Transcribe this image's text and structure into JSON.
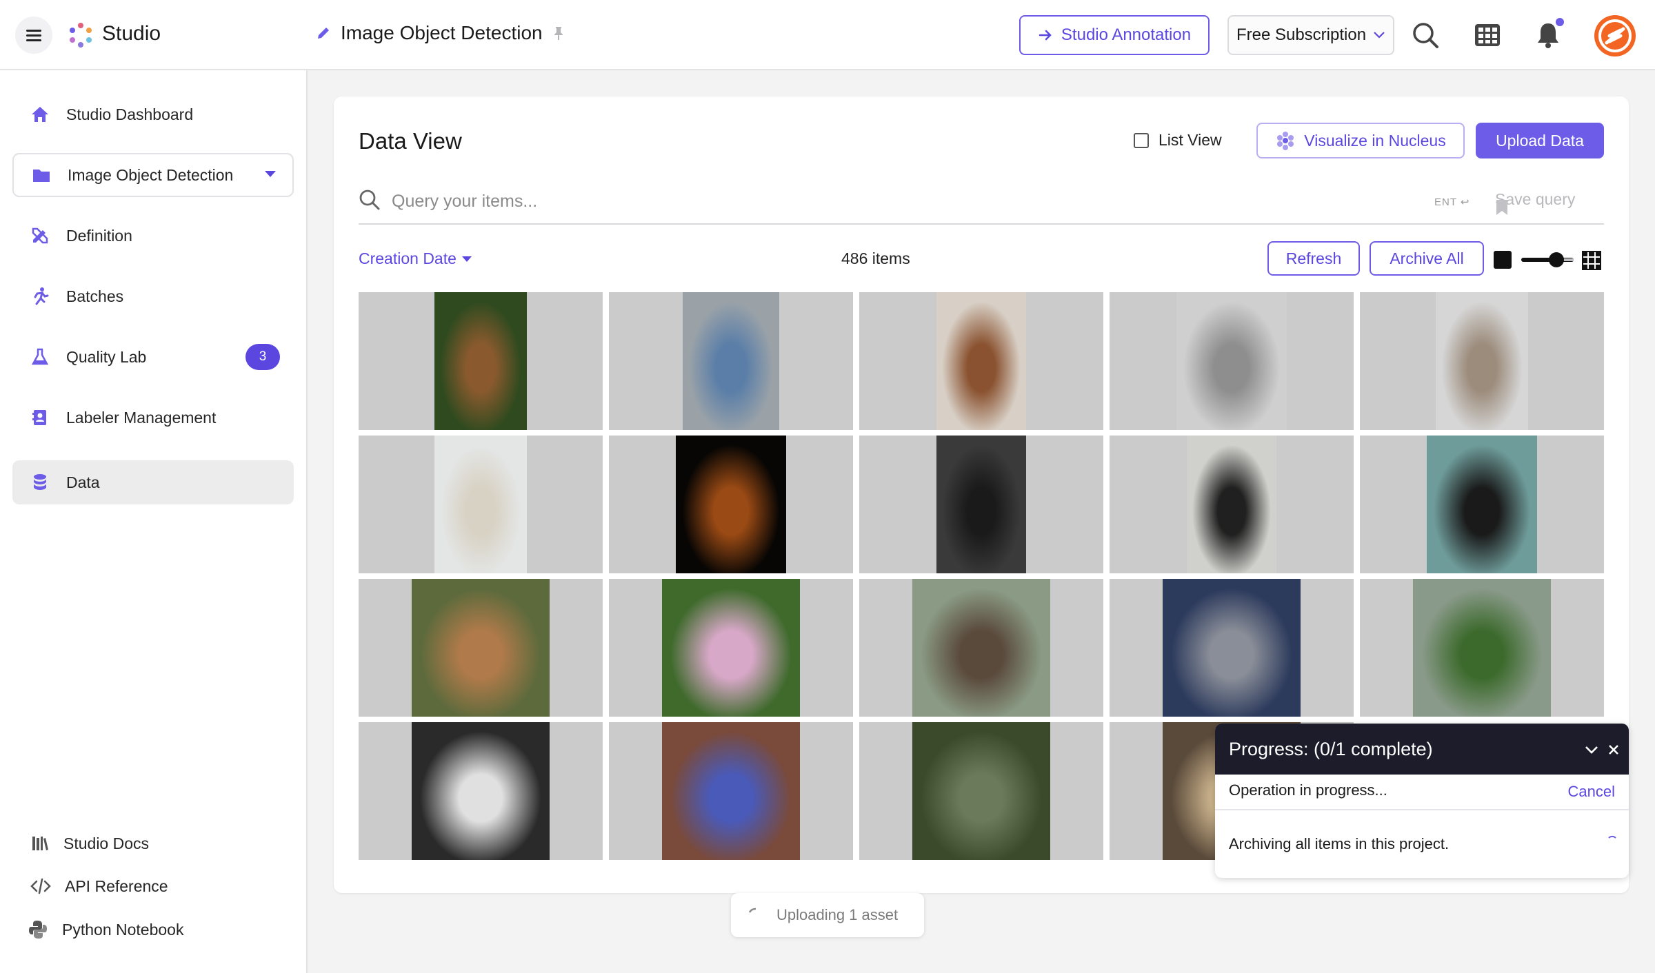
{
  "topbar": {
    "app_name": "Studio",
    "project_title": "Image Object Detection",
    "annotation_button": "Studio Annotation",
    "subscription": "Free Subscription"
  },
  "sidebar": {
    "items": [
      {
        "label": "Studio Dashboard",
        "icon": "home-icon"
      },
      {
        "label": "Image Object Detection",
        "icon": "folder-icon"
      },
      {
        "label": "Definition",
        "icon": "pencil-ruler-icon"
      },
      {
        "label": "Batches",
        "icon": "running-person-icon"
      },
      {
        "label": "Quality Lab",
        "icon": "flask-icon",
        "badge": "3"
      },
      {
        "label": "Labeler Management",
        "icon": "contact-book-icon"
      },
      {
        "label": "Data",
        "icon": "database-icon"
      }
    ],
    "footer": [
      {
        "label": "Studio Docs",
        "icon": "books-icon"
      },
      {
        "label": "API Reference",
        "icon": "code-icon"
      },
      {
        "label": "Python Notebook",
        "icon": "python-icon"
      }
    ]
  },
  "main": {
    "title": "Data View",
    "list_view_label": "List View",
    "visualize_button": "Visualize in Nucleus",
    "upload_button": "Upload Data",
    "search_placeholder": "Query your items...",
    "ent_hint": "ENT",
    "save_query": "Save query",
    "sort_label": "Creation Date",
    "item_count": "486 items",
    "refresh_button": "Refresh",
    "archive_all_button": "Archive All",
    "images": [
      {
        "subject": "wooden chair on grass",
        "colors": [
          "#2f4a1f",
          "#8a5a2e"
        ]
      },
      {
        "subject": "blue armchair",
        "colors": [
          "#9aa2a8",
          "#5a7ea8"
        ]
      },
      {
        "subject": "brown leather office chair",
        "colors": [
          "#d8d0c6",
          "#8a5230"
        ]
      },
      {
        "subject": "grey fabric chair",
        "colors": [
          "#cfcfcf",
          "#8e8e8e"
        ]
      },
      {
        "subject": "beige lounge chair",
        "colors": [
          "#d6d6d6",
          "#9c8c7c"
        ]
      },
      {
        "subject": "white tufted chair",
        "colors": [
          "#e4e6e6",
          "#d8d2c4"
        ]
      },
      {
        "subject": "chair in spotlight",
        "colors": [
          "#080604",
          "#9a4a14"
        ]
      },
      {
        "subject": "black plastic bar stool",
        "colors": [
          "#3a3a3a",
          "#1a1a1a"
        ]
      },
      {
        "subject": "black eames stool",
        "colors": [
          "#d0d0cc",
          "#202020"
        ]
      },
      {
        "subject": "black chair on teal",
        "colors": [
          "#6e9c9a",
          "#1a1a1a"
        ]
      },
      {
        "subject": "rabbit",
        "colors": [
          "#5c6a3c",
          "#b07a4a"
        ]
      },
      {
        "subject": "orchid flower",
        "colors": [
          "#3f6a2c",
          "#d8a8c8"
        ]
      },
      {
        "subject": "building in field",
        "colors": [
          "#8a9a84",
          "#5a4a3c"
        ]
      },
      {
        "subject": "telephone",
        "colors": [
          "#2c3a5c",
          "#8a8e98"
        ]
      },
      {
        "subject": "house with lawn",
        "colors": [
          "#8a9a8a",
          "#3c6a2c"
        ]
      },
      {
        "subject": "keyboard keys",
        "colors": [
          "#2a2a2a",
          "#e0e0e0"
        ]
      },
      {
        "subject": "blue motorbike",
        "colors": [
          "#7a4a3a",
          "#4a5ab8"
        ]
      },
      {
        "subject": "person in field",
        "colors": [
          "#3a4a2a",
          "#6a7a5a"
        ]
      },
      {
        "subject": "mushroom",
        "colors": [
          "#5a4a3a",
          "#c8b08a"
        ]
      }
    ]
  },
  "progress": {
    "title": "Progress: (0/1 complete)",
    "status": "Operation in progress...",
    "cancel": "Cancel",
    "message": "Archiving all items in this project."
  },
  "toast": {
    "text": "Uploading 1 asset"
  },
  "colors": {
    "accent": "#6c5ce7",
    "dark_header": "#1c1c2b",
    "avatar": "#f26522"
  }
}
